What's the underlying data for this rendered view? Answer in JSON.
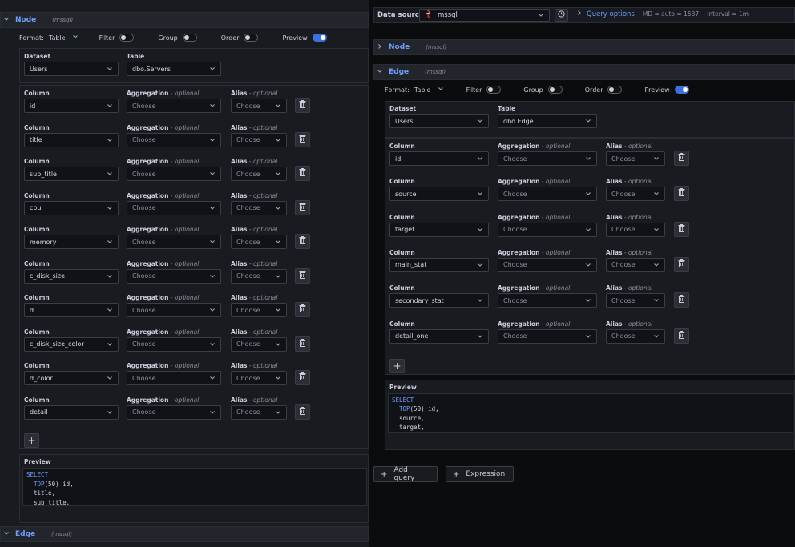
{
  "left": {
    "node_header": {
      "name": "Node",
      "datasource": "(mssql)"
    },
    "edge_header": {
      "name": "Edge",
      "datasource": "(mssql)"
    },
    "format_bar": {
      "format_label": "Format:",
      "format_value": "Table",
      "filter_label": "Filter",
      "group_label": "Group",
      "order_label": "Order",
      "preview_label": "Preview"
    },
    "dataset_label": "Dataset",
    "table_label": "Table",
    "dataset_value": "Users",
    "table_value": "dbo.Servers",
    "column_label": "Column",
    "aggregation_label": "Aggregation",
    "alias_label": "Alias",
    "optional_label": " - optional",
    "choose_placeholder": "Choose",
    "columns": [
      "id",
      "title",
      "sub_title",
      "cpu",
      "memory",
      "c_disk_size",
      "d",
      "c_disk_size_color",
      "d_color",
      "detail"
    ],
    "add_symbol": "+",
    "preview_label": "Preview",
    "sql": {
      "select": "SELECT",
      "top": "TOP",
      "line1_rest": "(50) id,",
      "line2": "title,",
      "line3": "sub_title,"
    }
  },
  "right": {
    "toolbar": {
      "datasource_label": "Data source",
      "datasource_value": "mssql",
      "query_options_label": "Query options",
      "md_info": "MD = auto = 1537",
      "interval_info": "Interval = 1m"
    },
    "node_header": {
      "name": "Node",
      "datasource": "(mssql)"
    },
    "edge_header": {
      "name": "Edge",
      "datasource": "(mssql)"
    },
    "format_bar": {
      "format_label": "Format:",
      "format_value": "Table",
      "filter_label": "Filter",
      "group_label": "Group",
      "order_label": "Order",
      "preview_label": "Preview"
    },
    "dataset_label": "Dataset",
    "table_label": "Table",
    "dataset_value": "Users",
    "table_value": "dbo.Edge",
    "column_label": "Column",
    "aggregation_label": "Aggregation",
    "alias_label": "Alias",
    "optional_label": " - optional",
    "choose_placeholder": "Choose",
    "columns": [
      "id",
      "source",
      "target",
      "main_stat",
      "secondary_stat",
      "detail_one"
    ],
    "add_symbol": "+",
    "preview_label": "Preview",
    "sql": {
      "select": "SELECT",
      "top": "TOP",
      "line1_rest": "(50) id,",
      "line2": "source,",
      "line3": "target,"
    },
    "add_query_label": "Add query",
    "expression_label": "Expression"
  },
  "colors": {
    "accent": "#6e9fff",
    "toggle_on": "#3d71d9",
    "panel_bg": "#181b1f",
    "page_bg": "#0b0c0e"
  }
}
